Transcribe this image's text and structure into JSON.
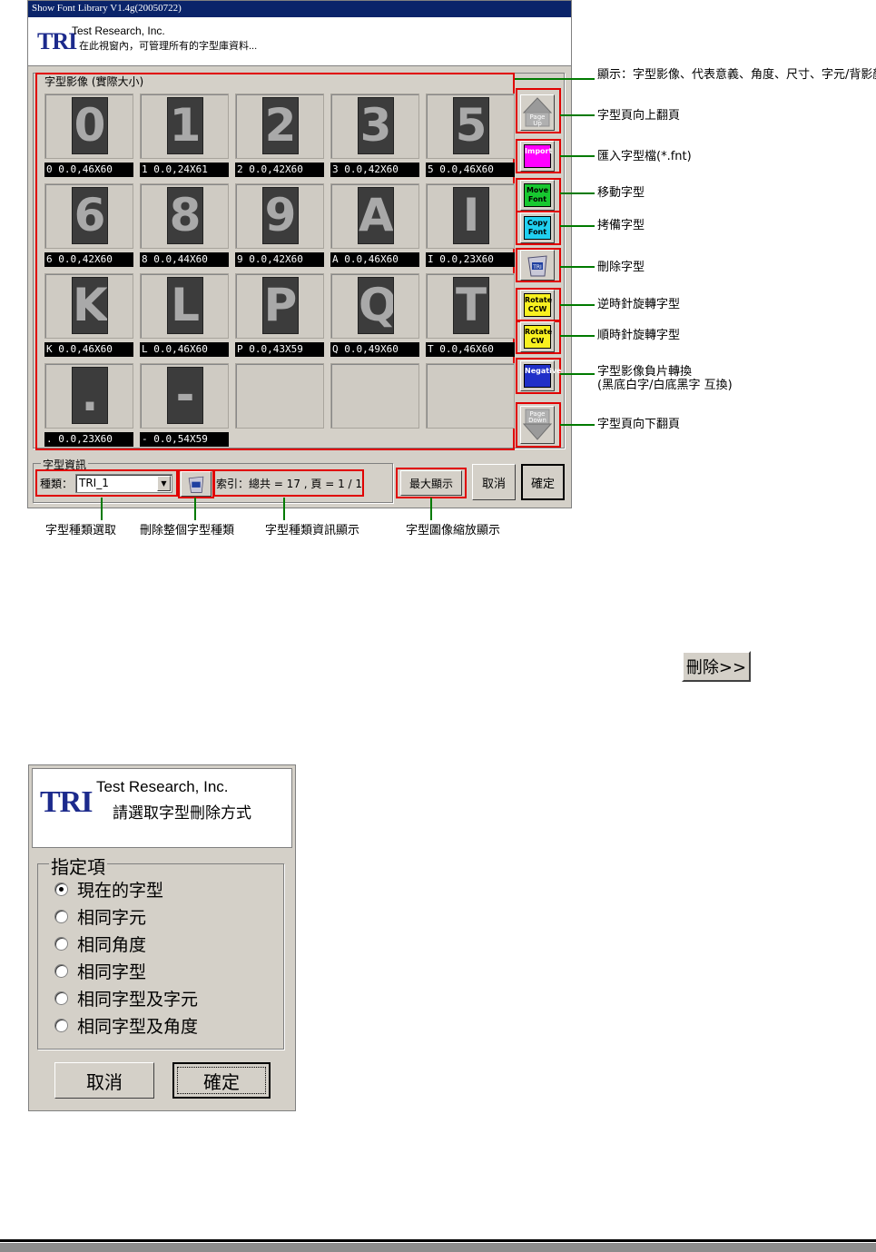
{
  "main_window": {
    "title": "Show Font Library V1.4g(20050722)",
    "logo": "TRI",
    "company": "Test Research, Inc.",
    "subtitle": "在此視窗內，可管理所有的字型庫資料...",
    "gallery_label": "字型影像 (實際大小)",
    "cells": [
      {
        "glyph": "0",
        "caption": "0 0.0,46X60"
      },
      {
        "glyph": "1",
        "caption": "1 0.0,24X61"
      },
      {
        "glyph": "2",
        "caption": "2 0.0,42X60"
      },
      {
        "glyph": "3",
        "caption": "3 0.0,42X60"
      },
      {
        "glyph": "5",
        "caption": "5 0.0,46X60"
      },
      {
        "glyph": "6",
        "caption": "6 0.0,42X60"
      },
      {
        "glyph": "8",
        "caption": "8 0.0,44X60"
      },
      {
        "glyph": "9",
        "caption": "9 0.0,42X60"
      },
      {
        "glyph": "A",
        "caption": "A 0.0,46X60"
      },
      {
        "glyph": "I",
        "caption": "I 0.0,23X60"
      },
      {
        "glyph": "K",
        "caption": "K 0.0,46X60"
      },
      {
        "glyph": "L",
        "caption": "L 0.0,46X60"
      },
      {
        "glyph": "P",
        "caption": "P 0.0,43X59"
      },
      {
        "glyph": "Q",
        "caption": "Q 0.0,49X60"
      },
      {
        "glyph": "T",
        "caption": "T 0.0,46X60"
      },
      {
        "glyph": ".",
        "caption": ". 0.0,23X60"
      },
      {
        "glyph": "-",
        "caption": "- 0.0,54X59"
      },
      {
        "glyph": "",
        "caption": ""
      },
      {
        "glyph": "",
        "caption": ""
      },
      {
        "glyph": "",
        "caption": ""
      }
    ],
    "toolbar": {
      "page_up": "Page Up",
      "import": "Import",
      "move": "Move Font",
      "copy": "Copy Font",
      "delete_icon_text": "TRI",
      "rotate_ccw": "Rotate CCW",
      "rotate_cw": "Rotate CW",
      "negative": "Negative",
      "page_down": "Page Down"
    },
    "info_label": "字型資訊",
    "type_label": "種類：",
    "type_value": "TRI_1",
    "index_text": "索引：總共 = 17 , 頁 = 1 / 1",
    "max_display": "最大顯示",
    "cancel": "取消",
    "ok": "確定"
  },
  "annotations": {
    "display": "顯示：字型影像、代表意義、角度、尺寸、字元/背影顏色",
    "page_up": "字型頁向上翻頁",
    "import": "匯入字型檔(*.fnt)",
    "move": "移動字型",
    "copy": "拷備字型",
    "delete": "刪除字型",
    "rotate_ccw": "逆時針旋轉字型",
    "rotate_cw": "順時針旋轉字型",
    "negative_line1": "字型影像負片轉換",
    "negative_line2": "(黑底白字/白底黑字 互換)",
    "page_down": "字型頁向下翻頁",
    "type_select": "字型種類選取",
    "delete_type": "刪除整個字型種類",
    "type_info": "字型種類資訊顯示",
    "zoom": "字型圖像縮放顯示"
  },
  "delete_button": "刪除>>",
  "delete_dialog": {
    "logo": "TRI",
    "company": "Test Research, Inc.",
    "subtitle": "請選取字型刪除方式",
    "group_label": "指定項",
    "options": [
      "現在的字型",
      "相同字元",
      "相同角度",
      "相同字型",
      "相同字型及字元",
      "相同字型及角度"
    ],
    "selected_index": 0,
    "cancel": "取消",
    "ok": "確定"
  },
  "colors": {
    "highlight": "#e00000",
    "leader": "#007a00",
    "titlebar": "#0a246a",
    "face": "#d4d0c8"
  }
}
